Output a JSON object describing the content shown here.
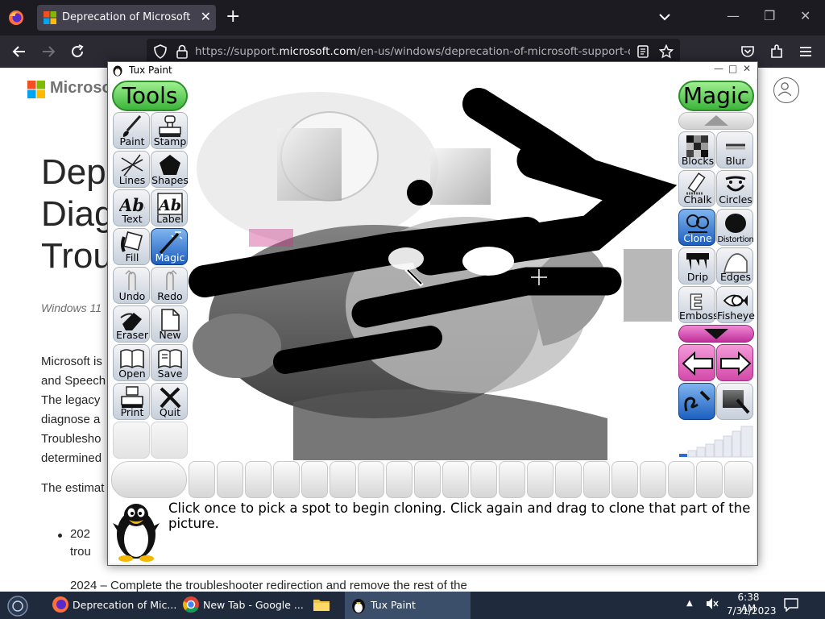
{
  "browser": {
    "tab": {
      "title": "Deprecation of Microsoft Support and Recovery Assistant"
    },
    "url": {
      "prefix": "https://support.",
      "domain": "microsoft.com",
      "path": "/en-us/windows/deprecation-of-microsoft-support-diagnostic-tool"
    }
  },
  "webpage": {
    "brand": "Microsoft",
    "title": "Deprecation of Microsoft Support Diagnostic Tool (MSDT) and MSDT Troubleshooters",
    "title_visible": "Dep\nDiag\nTrou",
    "meta": "Windows 11",
    "body_visible": "Microsoft is\nand Speech\nThe legacy\ndiagnose a\nTroublesho\ndetermined",
    "estimate_visible": "The estimat",
    "bullet1_visible": "202\ntrou",
    "bullet2_visible": "2024 – Complete the troubleshooter redirection and remove the rest of the"
  },
  "tuxpaint": {
    "window_title": "Tux Paint",
    "tools_header": "Tools",
    "magic_header": "Magic",
    "tools": [
      {
        "label": "Paint",
        "icon": "paintbrush-icon"
      },
      {
        "label": "Stamp",
        "icon": "stamp-icon"
      },
      {
        "label": "Lines",
        "icon": "lines-icon"
      },
      {
        "label": "Shapes",
        "icon": "pentagon-icon"
      },
      {
        "label": "Text",
        "icon": "text-abc-icon"
      },
      {
        "label": "Label",
        "icon": "label-abc-icon"
      },
      {
        "label": "Fill",
        "icon": "paint-bucket-icon"
      },
      {
        "label": "Magic",
        "icon": "magic-wand-icon",
        "selected": true
      },
      {
        "label": "Undo",
        "icon": "undo-hand-icon"
      },
      {
        "label": "Redo",
        "icon": "redo-hand-icon"
      },
      {
        "label": "Eraser",
        "icon": "eraser-icon"
      },
      {
        "label": "New",
        "icon": "new-page-icon"
      },
      {
        "label": "Open",
        "icon": "open-book-icon"
      },
      {
        "label": "Save",
        "icon": "save-book-icon"
      },
      {
        "label": "Print",
        "icon": "printer-icon"
      },
      {
        "label": "Quit",
        "icon": "quit-x-icon"
      }
    ],
    "magic_tools": [
      {
        "label": "Blocks",
        "icon": "blocks-icon"
      },
      {
        "label": "Blur",
        "icon": "blur-icon"
      },
      {
        "label": "Chalk",
        "icon": "chalk-icon"
      },
      {
        "label": "Circles",
        "icon": "circles-icon"
      },
      {
        "label": "Clone",
        "icon": "clone-icon",
        "selected": true
      },
      {
        "label": "Distortion",
        "icon": "distortion-icon"
      },
      {
        "label": "Drip",
        "icon": "drip-icon"
      },
      {
        "label": "Edges",
        "icon": "edges-icon"
      },
      {
        "label": "Emboss",
        "icon": "emboss-icon"
      },
      {
        "label": "Fisheye",
        "icon": "fisheye-icon"
      }
    ],
    "instruction": "Click once to pick a spot to begin cloning. Click again and drag to clone that part of the picture."
  },
  "taskbar": {
    "items": [
      {
        "label": "Deprecation of Mic...",
        "icon": "firefox-icon"
      },
      {
        "label": "New Tab - Google ...",
        "icon": "chrome-icon"
      },
      {
        "label": "",
        "icon": "file-explorer-icon"
      },
      {
        "label": "Tux Paint",
        "icon": "tux-icon"
      }
    ],
    "time": "6:38 AM",
    "date": "7/31/2023"
  }
}
